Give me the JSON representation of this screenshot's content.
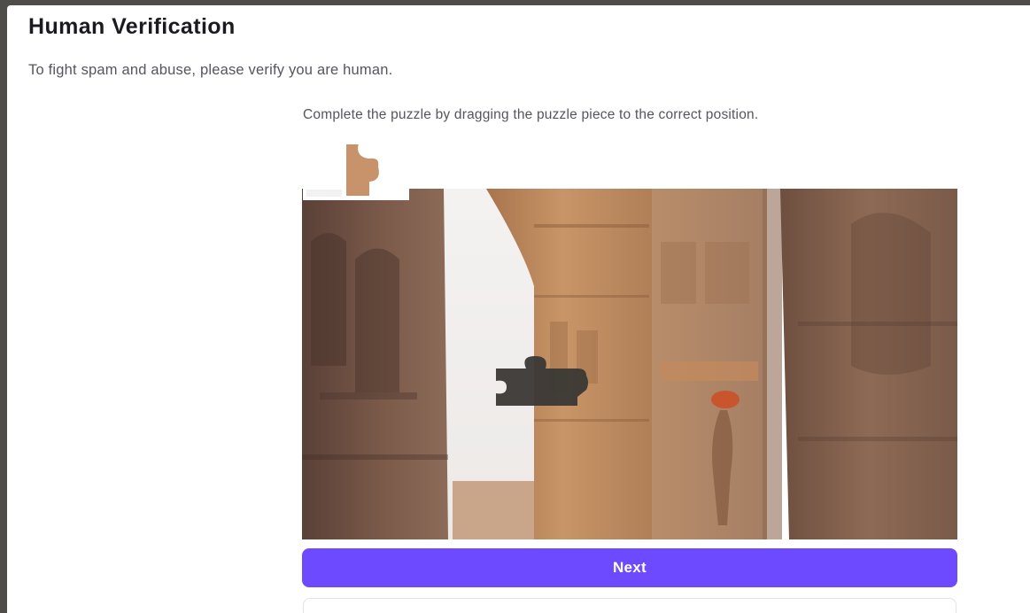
{
  "header": {
    "title": "Human Verification",
    "subtitle": "To fight spam and abuse, please verify you are human."
  },
  "captcha": {
    "instruction": "Complete the puzzle by dragging the puzzle piece to the correct position.",
    "image_subject": "Karnak temple columns with hieroglyph carvings",
    "piece_state": "not-placed"
  },
  "actions": {
    "next_label": "Next",
    "secondary_label": ""
  },
  "colors": {
    "accent": "#6d4aff",
    "backdrop": "#4f4d49",
    "text_primary": "#1b1b1f",
    "text_secondary": "#55565d",
    "slot": "#3a3835"
  }
}
